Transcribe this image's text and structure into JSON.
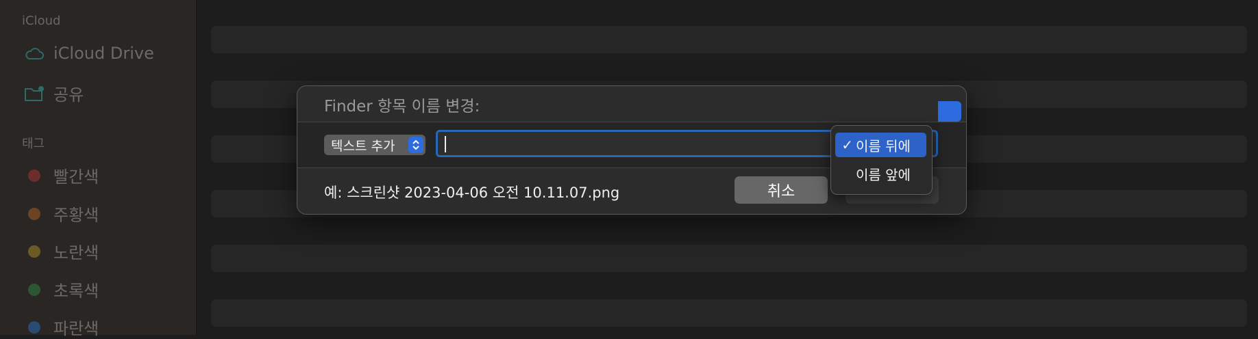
{
  "sidebar": {
    "icloud_section": "iCloud",
    "icloud_items": [
      {
        "label": "iCloud Drive",
        "icon": "cloud-icon"
      },
      {
        "label": "공유",
        "icon": "shared-folder-icon"
      }
    ],
    "tags_section": "태그",
    "tags": [
      {
        "label": "빨간색",
        "color": "#6b2e2c"
      },
      {
        "label": "주황색",
        "color": "#6b4426"
      },
      {
        "label": "노란색",
        "color": "#6b5a26"
      },
      {
        "label": "초록색",
        "color": "#2e5633"
      },
      {
        "label": "파란색",
        "color": "#2b4b73"
      }
    ]
  },
  "dialog": {
    "title": "Finder 항목 이름 변경:",
    "format_popup": "텍스트 추가",
    "text_value": "",
    "example": "예: 스크린샷 2023-04-06 오전 10.11.07.png",
    "cancel_label": "취소",
    "rename_label": "이름 변경"
  },
  "position_menu": {
    "items": [
      {
        "label": "이름 뒤에",
        "checked": true
      },
      {
        "label": "이름 앞에",
        "checked": false
      }
    ]
  },
  "colors": {
    "accent": "#2d6be0",
    "field_border": "#2569b8"
  }
}
